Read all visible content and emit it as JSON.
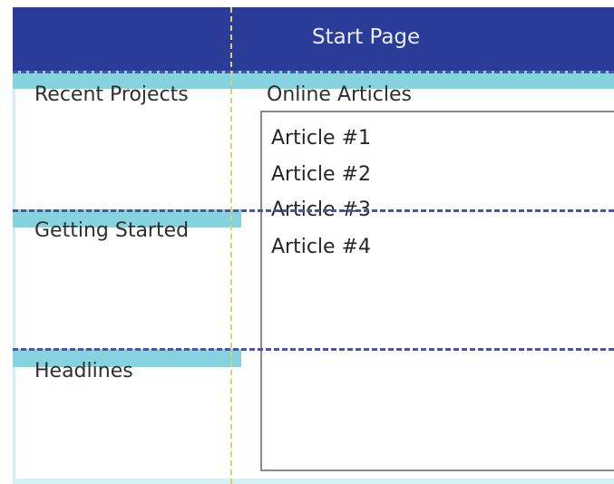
{
  "header": {
    "title": "Start Page"
  },
  "left_sections": [
    {
      "label": "Recent Projects"
    },
    {
      "label": "Getting Started"
    },
    {
      "label": "Headlines"
    }
  ],
  "online_articles": {
    "heading": "Online Articles",
    "items": [
      "Article #1",
      "Article #2",
      "Article #3",
      "Article #4"
    ]
  },
  "colors": {
    "header_bg": "#2b3b98",
    "band": "#86d3e0",
    "guide_dash": "#4a55a8",
    "guide_vertical": "#d9d36a"
  }
}
